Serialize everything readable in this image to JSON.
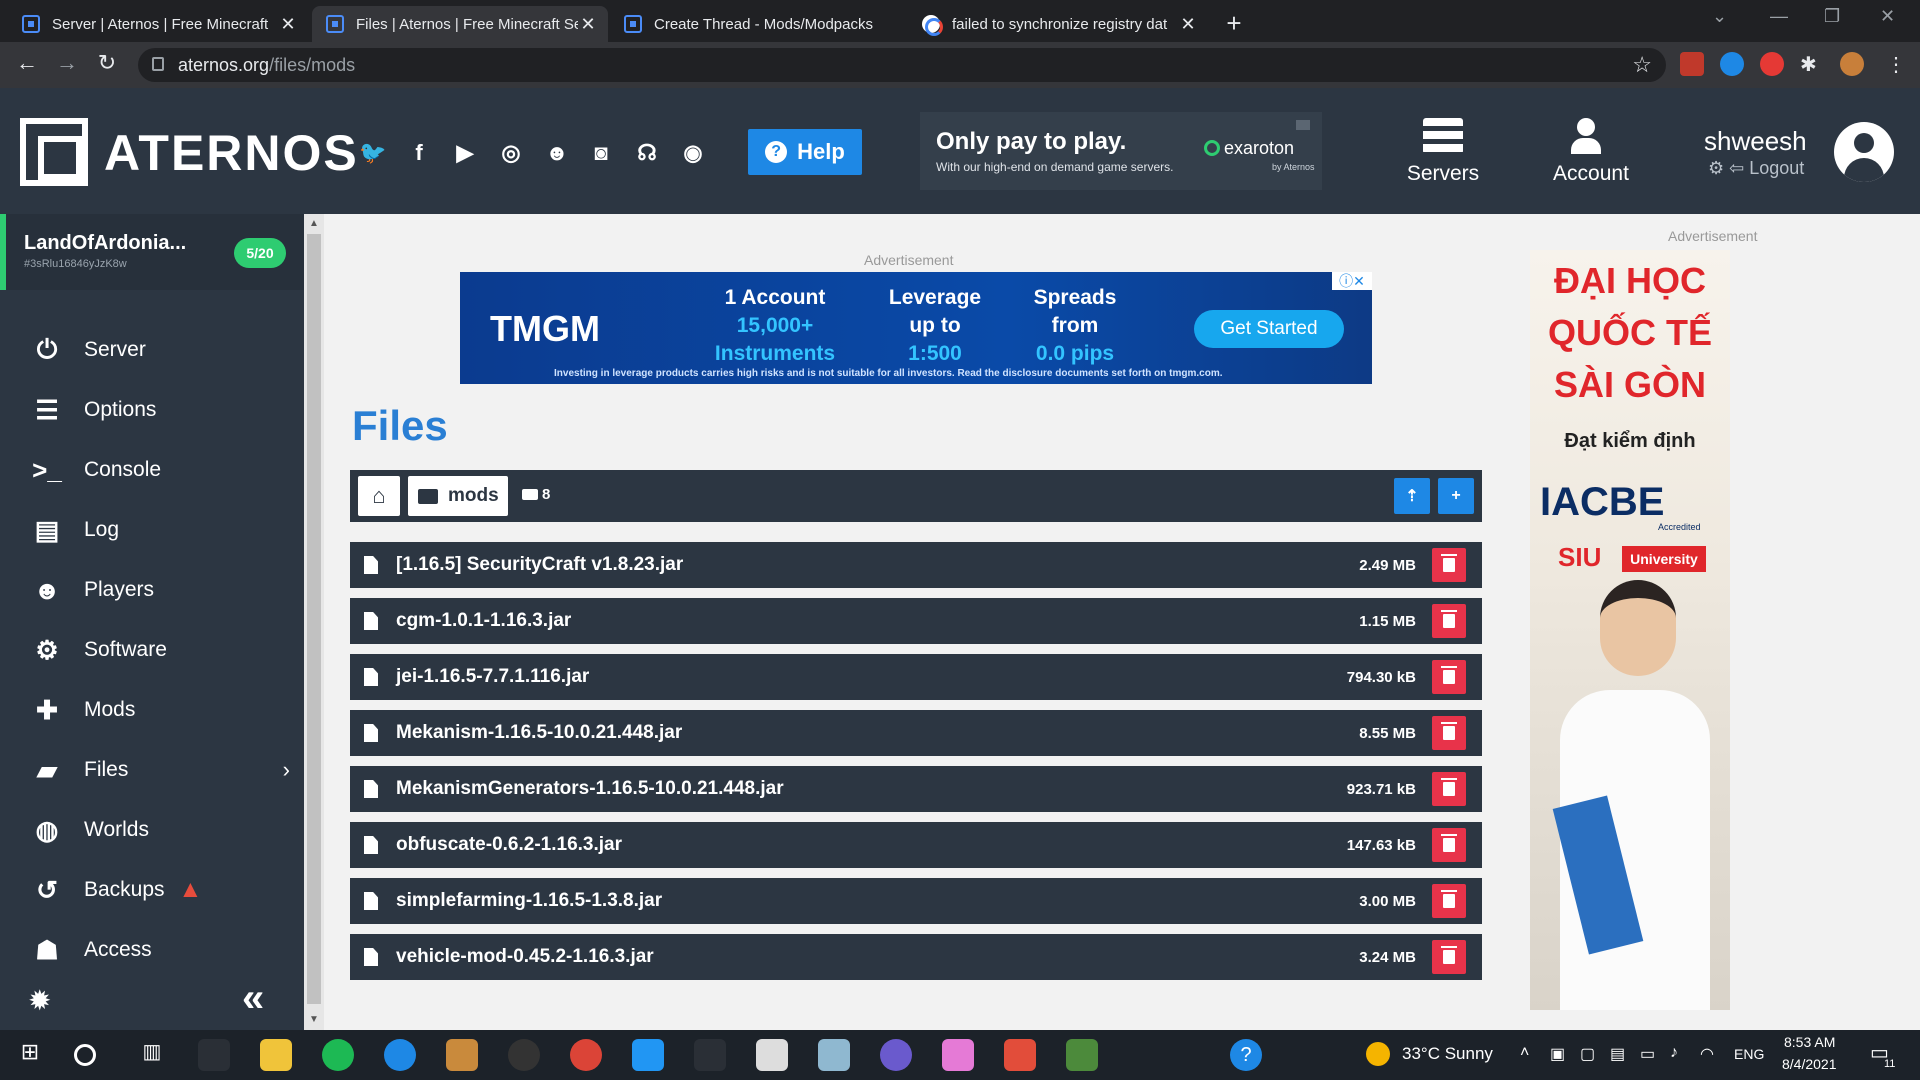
{
  "browser": {
    "tabs": [
      {
        "title": "Server | Aternos | Free Minecraft",
        "active": false
      },
      {
        "title": "Files | Aternos | Free Minecraft Se",
        "active": true
      },
      {
        "title": "Create Thread - Mods/Modpacks",
        "active": false
      },
      {
        "title": "failed to synchronize registry dat",
        "active": false
      }
    ],
    "url_host": "aternos.org",
    "url_path": "/files/mods"
  },
  "header": {
    "logo": "ATERNOS",
    "help_label": "Help",
    "promo_title": "Only pay to play.",
    "promo_sub": "With our high-end on demand game servers.",
    "promo_brand": "exaroton",
    "promo_by": "by Aternos",
    "nav_servers": "Servers",
    "nav_account": "Account",
    "username": "shweesh",
    "logout_label": "Logout"
  },
  "sidebar": {
    "server_name": "LandOfArdonia...",
    "server_id": "#3sRlu16846yJzK8w",
    "players": "5/20",
    "items": [
      {
        "label": "Server",
        "icon": "power-icon"
      },
      {
        "label": "Options",
        "icon": "sliders-icon"
      },
      {
        "label": "Console",
        "icon": "terminal-icon"
      },
      {
        "label": "Log",
        "icon": "document-icon"
      },
      {
        "label": "Players",
        "icon": "users-icon"
      },
      {
        "label": "Software",
        "icon": "gears-icon"
      },
      {
        "label": "Mods",
        "icon": "puzzle-icon"
      },
      {
        "label": "Files",
        "icon": "folder-icon"
      },
      {
        "label": "Worlds",
        "icon": "globe-icon"
      },
      {
        "label": "Backups",
        "icon": "history-icon"
      },
      {
        "label": "Access",
        "icon": "user-lock-icon"
      }
    ]
  },
  "main": {
    "ad_label": "Advertisement",
    "ad": {
      "brand": "TMGM",
      "col1_a": "1 Account",
      "col1_b": "15,000+",
      "col1_c": "Instruments",
      "col2_a": "Leverage",
      "col2_b": "up to",
      "col2_c": "1:500",
      "col3_a": "Spreads",
      "col3_b": "from",
      "col3_c": "0.0 pips",
      "cta": "Get Started",
      "fine": "Investing in leverage products carries high risks and is not suitable for all investors. Read the disclosure documents set forth on tmgm.com."
    },
    "title": "Files",
    "breadcrumb": "mods",
    "folder_count": "8",
    "files": [
      {
        "name": "[1.16.5] SecurityCraft v1.8.23.jar",
        "size": "2.49 MB"
      },
      {
        "name": "cgm-1.0.1-1.16.3.jar",
        "size": "1.15 MB"
      },
      {
        "name": "jei-1.16.5-7.7.1.116.jar",
        "size": "794.30 kB"
      },
      {
        "name": "Mekanism-1.16.5-10.0.21.448.jar",
        "size": "8.55 MB"
      },
      {
        "name": "MekanismGenerators-1.16.5-10.0.21.448.jar",
        "size": "923.71 kB"
      },
      {
        "name": "obfuscate-0.6.2-1.16.3.jar",
        "size": "147.63 kB"
      },
      {
        "name": "simplefarming-1.16.5-1.3.8.jar",
        "size": "3.00 MB"
      },
      {
        "name": "vehicle-mod-0.45.2-1.16.3.jar",
        "size": "3.24 MB"
      }
    ],
    "side_ad": {
      "line1": "ĐẠI HỌC",
      "line2": "QUỐC TẾ",
      "line3": "SÀI GÒN",
      "line4": "Đạt kiểm định",
      "iacbe": "IACBE",
      "accredited": "Accredited",
      "siu": "SIU",
      "university": "University"
    }
  },
  "taskbar": {
    "weather": "33°C  Sunny",
    "lang": "ENG",
    "time": "8:53 AM",
    "date": "8/4/2021",
    "notif_count": "11"
  }
}
